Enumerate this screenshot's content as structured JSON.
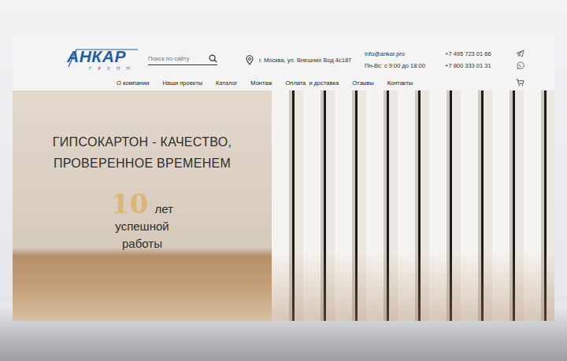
{
  "logo": {
    "name": "АНКАР",
    "sub": "ГРУПП"
  },
  "search": {
    "placeholder": "Поиск по сайту"
  },
  "address": "г. Москва, ул. Внешних Вод 4с187",
  "email": "info@ankar.pro",
  "hours": "Пн-Вс: с 9:00 до 18:00",
  "phones": [
    "+7 495 723 01 66",
    "+7 800 333 01 31"
  ],
  "nav": [
    "О компании",
    "Наши проекты",
    "Каталог",
    "Монтаж",
    "Оплата  и доставка",
    "Отзывы",
    "Контакты"
  ],
  "hero": {
    "title": [
      "ГИПСОКАРТОН - КАЧЕСТВО,",
      "ПРОВЕРЕННОЕ ВРЕМЕНЕМ"
    ],
    "years": "10",
    "years_lines": [
      "лет",
      "успешной",
      "работы"
    ]
  }
}
